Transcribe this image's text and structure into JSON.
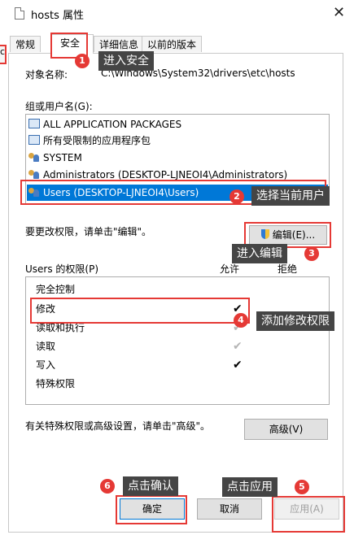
{
  "window": {
    "title": "hosts 属性",
    "close": "✕"
  },
  "left_fragment": "c",
  "tabs": [
    "常规",
    "安全",
    "详细信息",
    "以前的版本"
  ],
  "object_name_label": "对象名称:",
  "object_name_value": "C:\\Windows\\System32\\drivers\\etc\\hosts",
  "group_label": "组或用户名(G):",
  "users": [
    {
      "name": "ALL APPLICATION PACKAGES",
      "icon": "package-icon"
    },
    {
      "name": "所有受限制的应用程序包",
      "icon": "package-icon"
    },
    {
      "name": "SYSTEM",
      "icon": "user-group-icon"
    },
    {
      "name": "Administrators (DESKTOP-LJNEOI4\\Administrators)",
      "icon": "user-group-icon"
    },
    {
      "name": "Users (DESKTOP-LJNEOI4\\Users)",
      "icon": "user-group-icon",
      "selected": true
    }
  ],
  "change_perm_text": "要更改权限，请单击\"编辑\"。",
  "edit_button": "编辑(E)...",
  "perm_label": "Users 的权限(P)",
  "allow_header": "允许",
  "deny_header": "拒绝",
  "permissions": [
    {
      "name": "完全控制",
      "allow": ""
    },
    {
      "name": "修改",
      "allow": "✔"
    },
    {
      "name": "读取和执行",
      "allow": "✔",
      "grey": true
    },
    {
      "name": "读取",
      "allow": "✔",
      "grey": true
    },
    {
      "name": "写入",
      "allow": "✔"
    },
    {
      "name": "特殊权限",
      "allow": ""
    }
  ],
  "advanced_text": "有关特殊权限或高级设置，请单击\"高级\"。",
  "advanced_button": "高级(V)",
  "ok_button": "确定",
  "cancel_button": "取消",
  "apply_button": "应用(A)",
  "annotations": [
    {
      "num": "1",
      "text": "进入安全"
    },
    {
      "num": "2",
      "text": "选择当前用户"
    },
    {
      "num": "3",
      "text": "进入编辑"
    },
    {
      "num": "4",
      "text": "添加修改权限"
    },
    {
      "num": "5",
      "text": "点击应用"
    },
    {
      "num": "6",
      "text": "点击确认"
    }
  ],
  "colors": {
    "accent": "#0078d7",
    "annotation_red": "#e53935",
    "callout_bg": "#454545"
  }
}
